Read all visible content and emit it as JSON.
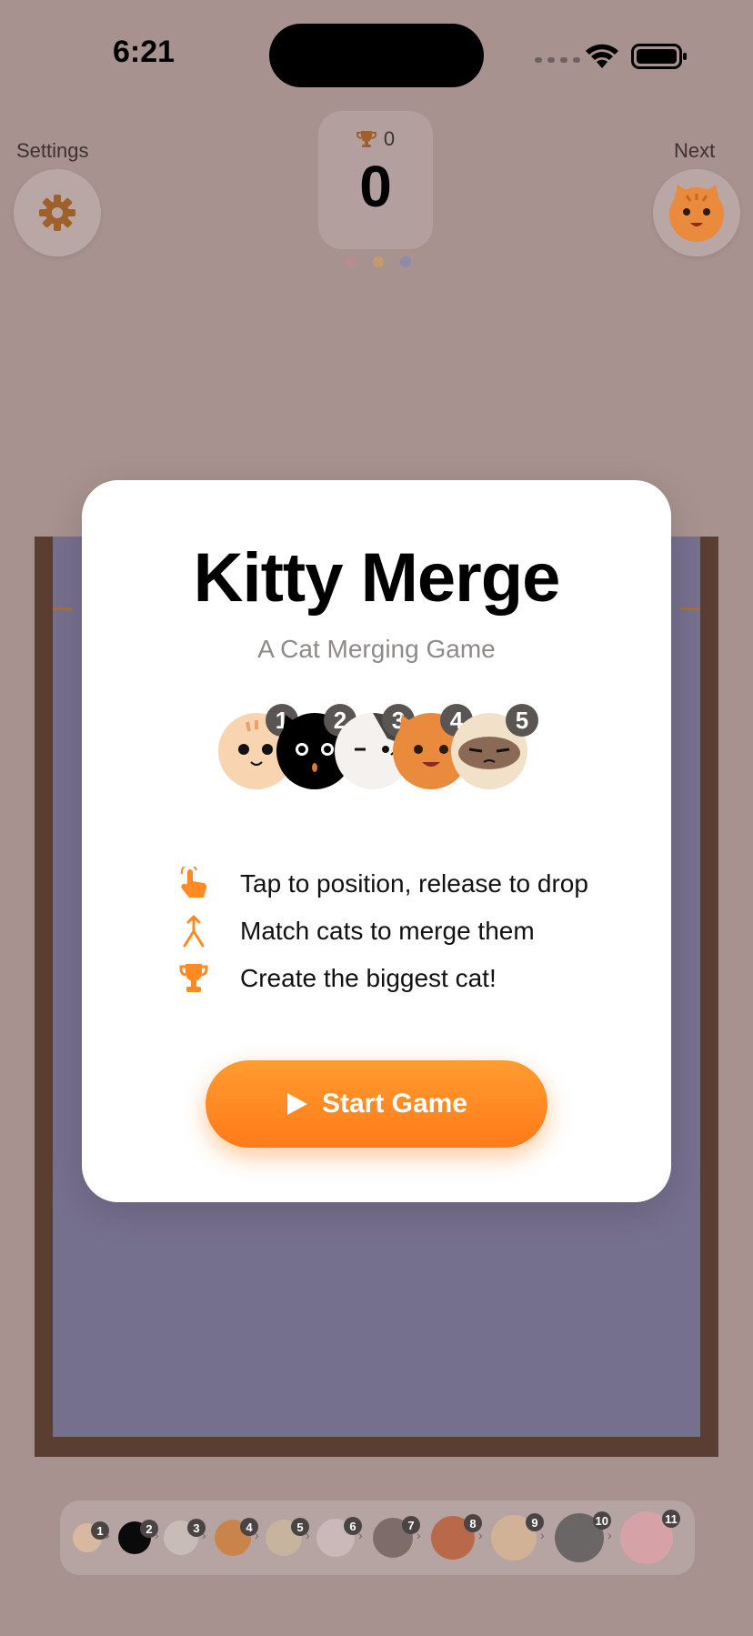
{
  "status": {
    "time": "6:21"
  },
  "header": {
    "settings_label": "Settings",
    "next_label": "Next",
    "best_score": "0",
    "score": "0"
  },
  "modal": {
    "title": "Kitty Merge",
    "subtitle": "A Cat Merging Game",
    "cats": [
      {
        "num": "1",
        "color": "#f8d5b0"
      },
      {
        "num": "2",
        "color": "#000000"
      },
      {
        "num": "3",
        "color": "#f4f1ee"
      },
      {
        "num": "4",
        "color": "#e98a3c"
      },
      {
        "num": "5",
        "color": "#f2e1c9"
      }
    ],
    "rules": [
      {
        "icon": "tap-hand-icon",
        "text": "Tap to position, release to drop"
      },
      {
        "icon": "merge-icon",
        "text": "Match cats to merge them"
      },
      {
        "icon": "trophy-icon",
        "text": "Create the biggest cat!"
      }
    ],
    "start_label": "Start Game"
  },
  "evolution": [
    {
      "num": "1",
      "color": "#d9b8a0"
    },
    {
      "num": "2",
      "color": "#0a0a0a"
    },
    {
      "num": "3",
      "color": "#c8bcb8"
    },
    {
      "num": "4",
      "color": "#c8844a"
    },
    {
      "num": "5",
      "color": "#c7b39e"
    },
    {
      "num": "6",
      "color": "#cbb8bb"
    },
    {
      "num": "7",
      "color": "#7e6c6a"
    },
    {
      "num": "8",
      "color": "#b9694a"
    },
    {
      "num": "9",
      "color": "#d2b297"
    },
    {
      "num": "10",
      "color": "#6a6666"
    },
    {
      "num": "11",
      "color": "#d7a1a8"
    }
  ],
  "colors": {
    "accent": "#ff8a24",
    "box": "#5a3e31",
    "box_fill": "#76708f"
  }
}
